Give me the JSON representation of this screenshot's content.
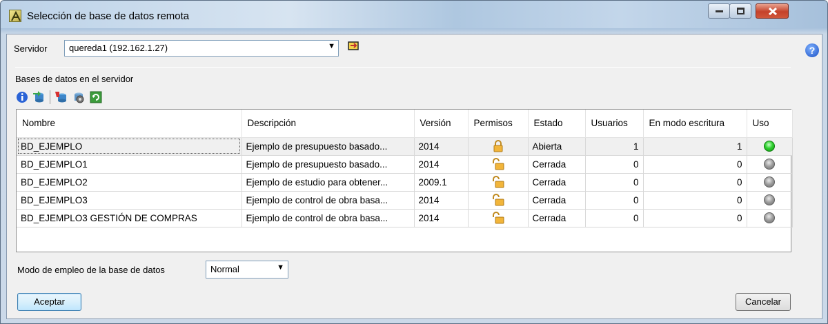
{
  "window": {
    "title": "Selección de base de datos remota"
  },
  "server": {
    "label": "Servidor",
    "selected": "quereda1 (192.162.1.27)"
  },
  "databases": {
    "section_label": "Bases de datos en el servidor",
    "toolbar_icons": [
      "info-icon",
      "connect-db-icon",
      "disconnect-db-icon",
      "db-settings-icon",
      "refresh-icon"
    ],
    "columns": [
      "Nombre",
      "Descripción",
      "Versión",
      "Permisos",
      "Estado",
      "Usuarios",
      "En modo escritura",
      "Uso"
    ],
    "rows": [
      {
        "nombre": "BD_EJEMPLO",
        "descripcion": "Ejemplo de presupuesto basado...",
        "version": "2014",
        "permisos": "locked",
        "estado": "Abierta",
        "usuarios": "1",
        "escritura": "1",
        "uso": "active"
      },
      {
        "nombre": "BD_EJEMPLO1",
        "descripcion": "Ejemplo de presupuesto basado...",
        "version": "2014",
        "permisos": "unlocked",
        "estado": "Cerrada",
        "usuarios": "0",
        "escritura": "0",
        "uso": "inactive"
      },
      {
        "nombre": "BD_EJEMPLO2",
        "descripcion": "Ejemplo de estudio para obtener...",
        "version": "2009.1",
        "permisos": "unlocked",
        "estado": "Cerrada",
        "usuarios": "0",
        "escritura": "0",
        "uso": "inactive"
      },
      {
        "nombre": "BD_EJEMPLO3",
        "descripcion": "Ejemplo de control de obra basa...",
        "version": "2014",
        "permisos": "unlocked",
        "estado": "Cerrada",
        "usuarios": "0",
        "escritura": "0",
        "uso": "inactive"
      },
      {
        "nombre": "BD_EJEMPLO3 GESTIÓN DE COMPRAS",
        "descripcion": "Ejemplo de control de obra basa...",
        "version": "2014",
        "permisos": "unlocked",
        "estado": "Cerrada",
        "usuarios": "0",
        "escritura": "0",
        "uso": "inactive"
      }
    ]
  },
  "mode": {
    "label": "Modo de empleo de la base de datos",
    "selected": "Normal"
  },
  "buttons": {
    "accept": "Aceptar",
    "cancel": "Cancelar"
  },
  "colors": {
    "active_dot": "#2fd12f",
    "inactive_dot": "#8a8a8a",
    "lock": "#f0b030"
  }
}
